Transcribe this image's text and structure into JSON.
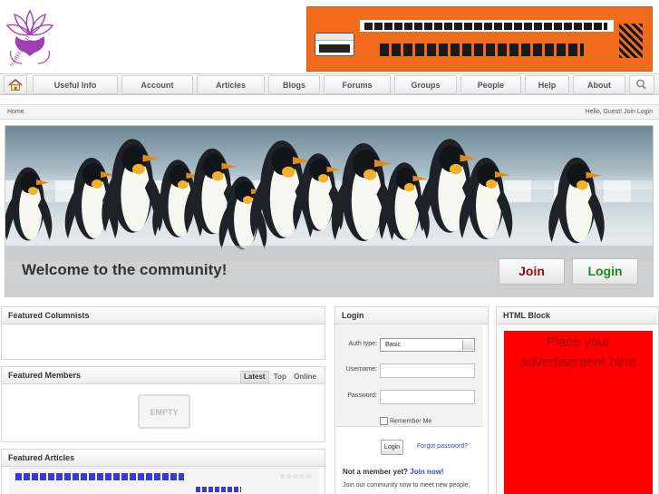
{
  "header": {
    "logo": {
      "icon": "lotus-logo-icon",
      "text": "NARIJOGOTH",
      "color": "#a03fb5"
    },
    "banner": {
      "icon": "tiger-stripe-icon",
      "accent": "#f26a1b"
    }
  },
  "nav": {
    "home_icon": "home-icon",
    "search_icon": "search-icon",
    "items": [
      {
        "label": "Useful Info"
      },
      {
        "label": "Account"
      },
      {
        "label": "Articles"
      },
      {
        "label": "Blogs"
      },
      {
        "label": "Forums"
      },
      {
        "label": "Groups"
      },
      {
        "label": "People"
      },
      {
        "label": "Help"
      },
      {
        "label": "About"
      }
    ]
  },
  "breadcrumb": {
    "home": "Home",
    "greeting": "Hello, Guest!",
    "join": "Join",
    "login": "Login"
  },
  "hero": {
    "title": "Welcome to the community!",
    "join_label": "Join",
    "login_label": "Login"
  },
  "featured_columnists": {
    "title": "Featured Columnists"
  },
  "featured_members": {
    "title": "Featured Members",
    "tabs": [
      "Latest",
      "Top",
      "Online"
    ],
    "empty_label": "EMPTY"
  },
  "featured_articles": {
    "title": "Featured Articles",
    "stars": "☆☆☆☆☆"
  },
  "login": {
    "title": "Login",
    "auth_label": "Auth type:",
    "auth_value": "Basic",
    "username_label": "Username:",
    "password_label": "Password:",
    "remember_label": "Remember Me",
    "button_label": "Login",
    "forgot_label": "Forgot password?",
    "member_question": "Not a member yet?",
    "join_now": "Join now!",
    "member_text": "Join our community now to meet new people;"
  },
  "html_block": {
    "title": "HTML Block",
    "ad_text": "Place your advertisement here",
    "color": "#ff0000"
  }
}
